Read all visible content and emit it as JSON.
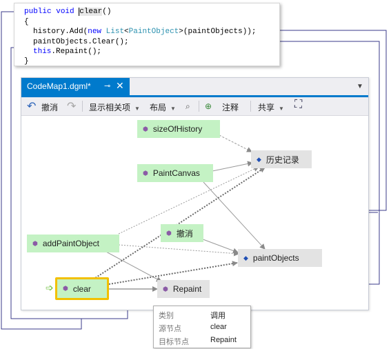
{
  "code": {
    "line1": {
      "kw1": "public",
      "kw2": "void",
      "method": "clear",
      "tail": "()"
    },
    "line2": "{",
    "line3": {
      "a": "history.Add(",
      "kw": "new",
      "b": " ",
      "type1": "List",
      "c": "<",
      "type2": "PaintObject",
      "d": ">(paintObjects));"
    },
    "line4": "paintObjects.Clear();",
    "line5": {
      "kw": "this",
      "rest": ".Repaint();"
    },
    "line6": "}"
  },
  "window": {
    "tab_title": "CodeMap1.dgml*",
    "pin_icon": "pin-icon",
    "close_icon": "close-icon",
    "overflow_icon": "dropdown-arrow-icon",
    "accent": "#007acc"
  },
  "toolbar": {
    "undo_label": "撤消",
    "show_related_label": "显示相关项",
    "layout_label": "布局",
    "comment_label": "注释",
    "share_label": "共享"
  },
  "graph": {
    "nodes": {
      "size_of_history": "sizeOfHistory",
      "paint_canvas": "PaintCanvas",
      "history": "历史记录",
      "undo": "撤消",
      "add_paint_object": "addPaintObject",
      "paint_objects": "paintObjects",
      "clear": "clear",
      "repaint": "Repaint"
    },
    "colors": {
      "method_node": "#c4f2c4",
      "field_node": "#e3e3e3",
      "selected_border": "#f2c000",
      "callout_line": "#3a3a8a"
    }
  },
  "tooltip": {
    "rows": [
      {
        "key": "类别",
        "value": "调用"
      },
      {
        "key": "源节点",
        "value": "clear"
      },
      {
        "key": "目标节点",
        "value": "Repaint"
      }
    ]
  }
}
